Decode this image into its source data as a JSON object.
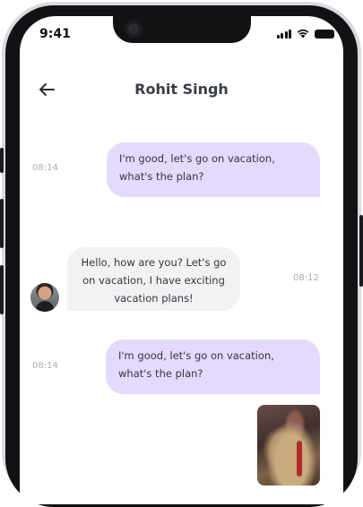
{
  "status_bar": {
    "time": "9:41"
  },
  "header": {
    "title": "Rohit Singh"
  },
  "messages": [
    {
      "direction": "outgoing",
      "time": "08:14",
      "text": "I'm good, let's go on vacation, what's the plan?"
    },
    {
      "direction": "incoming",
      "time": "08:12",
      "text": "Hello, how are you? Let's go on vacation, I have exciting vacation plans!"
    },
    {
      "direction": "outgoing",
      "time": "08:14",
      "text": "I'm good, let's go on vacation, what's the plan?"
    }
  ],
  "colors": {
    "outgoing_bubble": "#e3dafd",
    "incoming_bubble": "#f2f2f3"
  },
  "icons": [
    "back-arrow-icon",
    "signal-icon",
    "wifi-icon",
    "battery-icon"
  ]
}
